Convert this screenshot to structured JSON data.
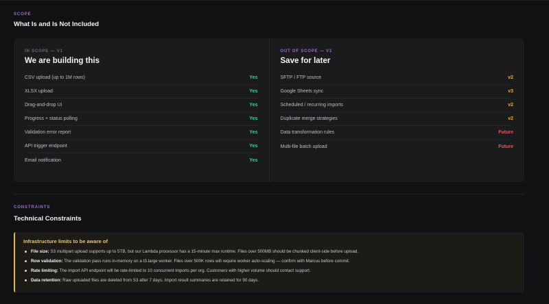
{
  "scope": {
    "label": "SCOPE",
    "title": "What Is and Is Not Included",
    "in_scope": {
      "label": "IN SCOPE — V1",
      "title": "We are building this",
      "items": [
        {
          "name": "CSV upload (up to 1M rows)",
          "value": "Yes"
        },
        {
          "name": "XLSX upload",
          "value": "Yes"
        },
        {
          "name": "Drag-and-drop UI",
          "value": "Yes"
        },
        {
          "name": "Progress + status polling",
          "value": "Yes"
        },
        {
          "name": "Validation error report",
          "value": "Yes"
        },
        {
          "name": "API trigger endpoint",
          "value": "Yes"
        },
        {
          "name": "Email notification",
          "value": "Yes"
        }
      ]
    },
    "out_scope": {
      "label": "OUT OF SCOPE — V1",
      "title": "Save for later",
      "items": [
        {
          "name": "SFTP / FTP source",
          "value": "v2"
        },
        {
          "name": "Google Sheets sync",
          "value": "v3"
        },
        {
          "name": "Scheduled / recurring imports",
          "value": "v2"
        },
        {
          "name": "Duplicate merge strategies",
          "value": "v2"
        },
        {
          "name": "Data transformation rules",
          "value": "Future"
        },
        {
          "name": "Multi-file batch upload",
          "value": "Future"
        }
      ]
    }
  },
  "constraints": {
    "label": "CONSTRAINTS",
    "title": "Technical Constraints",
    "callout": {
      "title": "Infrastructure limits to be aware of",
      "items": [
        {
          "term": "File size:",
          "text": " S3 multipart upload supports up to 5TB, but our Lambda processor has a 15-minute max runtime. Files over 500MB should be chunked client-side before upload."
        },
        {
          "term": "Row validation:",
          "text": " The validation pass runs in-memory on a t3.large worker. Files over 500K rows will require worker auto-scaling — confirm with Marcus before commit."
        },
        {
          "term": "Rate limiting:",
          "text": " The import API endpoint will be rate-limited to 10 concurrent imports per org. Customers with higher volume should contact support."
        },
        {
          "term": "Data retention:",
          "text": " Raw uploaded files are deleted from S3 after 7 days. Import result summaries are retained for 90 days."
        }
      ]
    }
  },
  "colors": {
    "accent": "#a06cd5",
    "yes": "#34d399",
    "version": "#f5a524",
    "future": "#f05252",
    "callout_border": "#e6b84a"
  }
}
